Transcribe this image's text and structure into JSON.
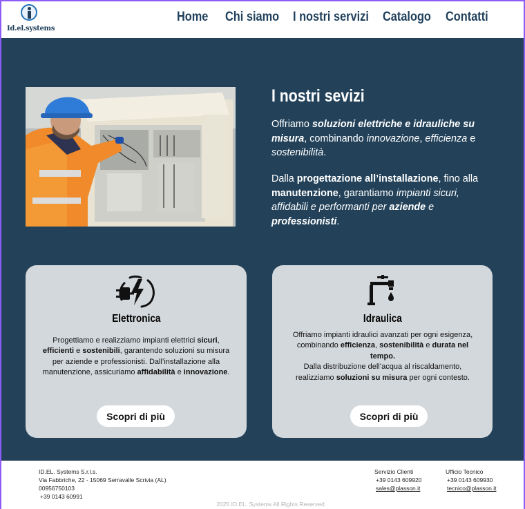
{
  "brand": {
    "logo_text": "Id.el.systems"
  },
  "nav": {
    "home": "Home",
    "chi_siamo": "Chi siamo",
    "servizi": "I nostri servizi",
    "catalogo": "Catalogo",
    "contatti": "Contatti"
  },
  "intro": {
    "title": "I nostri sevizi",
    "p1": {
      "t1": "Offriamo ",
      "b1": "soluzioni elettriche e idrauliche su misura",
      "t2": ", combinando ",
      "i1": "innovazione",
      "t3": ", ",
      "i2": "efficienza",
      "t4": " e ",
      "i3": "sostenibilità",
      "t5": "."
    },
    "p2": {
      "t1": "Dalla ",
      "b1": "progettazione all’installazione",
      "t2": ", fino alla ",
      "b2": "manutenzione",
      "t3": ", garantiamo ",
      "i1": "impianti sicuri, affidabili e performanti per",
      "t4": " ",
      "bi1": "aziende",
      "i2": " e ",
      "bi2": "professionisti",
      "t5": "."
    }
  },
  "cards": [
    {
      "icon": "plug-lightning-icon",
      "title": "Elettronica",
      "text": {
        "t1": "Progettiamo e realizziamo impianti elettrici ",
        "b1": "sicuri",
        "t2": ", ",
        "b2": "efficienti",
        "t3": " e ",
        "b3": "sostenibili",
        "t4": ", garantendo soluzioni su misura per aziende e professionisti. Dall’installazione alla manutenzione, assicuriamo ",
        "b4": "affidabilità",
        "t5": " e ",
        "b5": "innovazione",
        "t6": "."
      },
      "button": "Scopri di più"
    },
    {
      "icon": "faucet-drop-icon",
      "title": "Idraulica",
      "text": {
        "t1": "Offriamo impianti idraulici avanzati per ogni esigenza, combinando ",
        "b1": "efficienza",
        "t2": ", ",
        "b2": "sostenibilità",
        "t3": " e ",
        "b3": "durata nel tempo.",
        "t4": "Dalla distribuzione dell’acqua al riscaldamento, realizziamo ",
        "b4": "soluzioni su misura",
        "t5": " per ogni contesto."
      },
      "button": "Scopri di più"
    }
  ],
  "footer": {
    "company": "ID.EL. Systems S.r.l.s.",
    "address": "Via Fabbriche, 22 - 15069 Serravalle Scrivia (AL)",
    "vat": "00956750103",
    "phone": "+39 0143 60991",
    "service": {
      "title": "Servizio Clienti",
      "phone": "+39 0143 609920",
      "email": "sales@plasson.it"
    },
    "tech": {
      "title": "Ufficio Tecnico",
      "phone": "+39 0143 609930",
      "email": "tecnico@plasson.it"
    },
    "copyright": "2025 ID.EL. Systems All Rights Reserved"
  },
  "colors": {
    "primary": "#23425a",
    "card": "#d3d8dc",
    "nav_text": "#1f3f5b"
  }
}
